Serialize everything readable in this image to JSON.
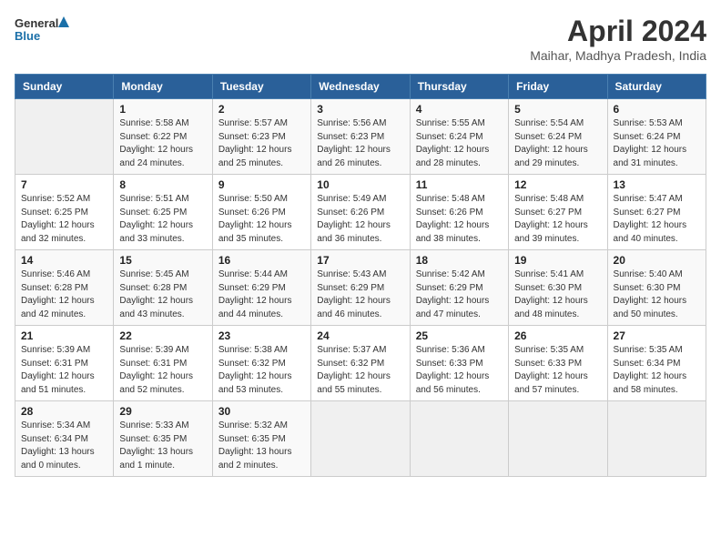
{
  "logo": {
    "line1": "General",
    "line2": "Blue"
  },
  "title": "April 2024",
  "subtitle": "Maihar, Madhya Pradesh, India",
  "weekdays": [
    "Sunday",
    "Monday",
    "Tuesday",
    "Wednesday",
    "Thursday",
    "Friday",
    "Saturday"
  ],
  "weeks": [
    [
      {
        "day": "",
        "info": ""
      },
      {
        "day": "1",
        "info": "Sunrise: 5:58 AM\nSunset: 6:22 PM\nDaylight: 12 hours\nand 24 minutes."
      },
      {
        "day": "2",
        "info": "Sunrise: 5:57 AM\nSunset: 6:23 PM\nDaylight: 12 hours\nand 25 minutes."
      },
      {
        "day": "3",
        "info": "Sunrise: 5:56 AM\nSunset: 6:23 PM\nDaylight: 12 hours\nand 26 minutes."
      },
      {
        "day": "4",
        "info": "Sunrise: 5:55 AM\nSunset: 6:24 PM\nDaylight: 12 hours\nand 28 minutes."
      },
      {
        "day": "5",
        "info": "Sunrise: 5:54 AM\nSunset: 6:24 PM\nDaylight: 12 hours\nand 29 minutes."
      },
      {
        "day": "6",
        "info": "Sunrise: 5:53 AM\nSunset: 6:24 PM\nDaylight: 12 hours\nand 31 minutes."
      }
    ],
    [
      {
        "day": "7",
        "info": "Sunrise: 5:52 AM\nSunset: 6:25 PM\nDaylight: 12 hours\nand 32 minutes."
      },
      {
        "day": "8",
        "info": "Sunrise: 5:51 AM\nSunset: 6:25 PM\nDaylight: 12 hours\nand 33 minutes."
      },
      {
        "day": "9",
        "info": "Sunrise: 5:50 AM\nSunset: 6:26 PM\nDaylight: 12 hours\nand 35 minutes."
      },
      {
        "day": "10",
        "info": "Sunrise: 5:49 AM\nSunset: 6:26 PM\nDaylight: 12 hours\nand 36 minutes."
      },
      {
        "day": "11",
        "info": "Sunrise: 5:48 AM\nSunset: 6:26 PM\nDaylight: 12 hours\nand 38 minutes."
      },
      {
        "day": "12",
        "info": "Sunrise: 5:48 AM\nSunset: 6:27 PM\nDaylight: 12 hours\nand 39 minutes."
      },
      {
        "day": "13",
        "info": "Sunrise: 5:47 AM\nSunset: 6:27 PM\nDaylight: 12 hours\nand 40 minutes."
      }
    ],
    [
      {
        "day": "14",
        "info": "Sunrise: 5:46 AM\nSunset: 6:28 PM\nDaylight: 12 hours\nand 42 minutes."
      },
      {
        "day": "15",
        "info": "Sunrise: 5:45 AM\nSunset: 6:28 PM\nDaylight: 12 hours\nand 43 minutes."
      },
      {
        "day": "16",
        "info": "Sunrise: 5:44 AM\nSunset: 6:29 PM\nDaylight: 12 hours\nand 44 minutes."
      },
      {
        "day": "17",
        "info": "Sunrise: 5:43 AM\nSunset: 6:29 PM\nDaylight: 12 hours\nand 46 minutes."
      },
      {
        "day": "18",
        "info": "Sunrise: 5:42 AM\nSunset: 6:29 PM\nDaylight: 12 hours\nand 47 minutes."
      },
      {
        "day": "19",
        "info": "Sunrise: 5:41 AM\nSunset: 6:30 PM\nDaylight: 12 hours\nand 48 minutes."
      },
      {
        "day": "20",
        "info": "Sunrise: 5:40 AM\nSunset: 6:30 PM\nDaylight: 12 hours\nand 50 minutes."
      }
    ],
    [
      {
        "day": "21",
        "info": "Sunrise: 5:39 AM\nSunset: 6:31 PM\nDaylight: 12 hours\nand 51 minutes."
      },
      {
        "day": "22",
        "info": "Sunrise: 5:39 AM\nSunset: 6:31 PM\nDaylight: 12 hours\nand 52 minutes."
      },
      {
        "day": "23",
        "info": "Sunrise: 5:38 AM\nSunset: 6:32 PM\nDaylight: 12 hours\nand 53 minutes."
      },
      {
        "day": "24",
        "info": "Sunrise: 5:37 AM\nSunset: 6:32 PM\nDaylight: 12 hours\nand 55 minutes."
      },
      {
        "day": "25",
        "info": "Sunrise: 5:36 AM\nSunset: 6:33 PM\nDaylight: 12 hours\nand 56 minutes."
      },
      {
        "day": "26",
        "info": "Sunrise: 5:35 AM\nSunset: 6:33 PM\nDaylight: 12 hours\nand 57 minutes."
      },
      {
        "day": "27",
        "info": "Sunrise: 5:35 AM\nSunset: 6:34 PM\nDaylight: 12 hours\nand 58 minutes."
      }
    ],
    [
      {
        "day": "28",
        "info": "Sunrise: 5:34 AM\nSunset: 6:34 PM\nDaylight: 13 hours\nand 0 minutes."
      },
      {
        "day": "29",
        "info": "Sunrise: 5:33 AM\nSunset: 6:35 PM\nDaylight: 13 hours\nand 1 minute."
      },
      {
        "day": "30",
        "info": "Sunrise: 5:32 AM\nSunset: 6:35 PM\nDaylight: 13 hours\nand 2 minutes."
      },
      {
        "day": "",
        "info": ""
      },
      {
        "day": "",
        "info": ""
      },
      {
        "day": "",
        "info": ""
      },
      {
        "day": "",
        "info": ""
      }
    ]
  ]
}
